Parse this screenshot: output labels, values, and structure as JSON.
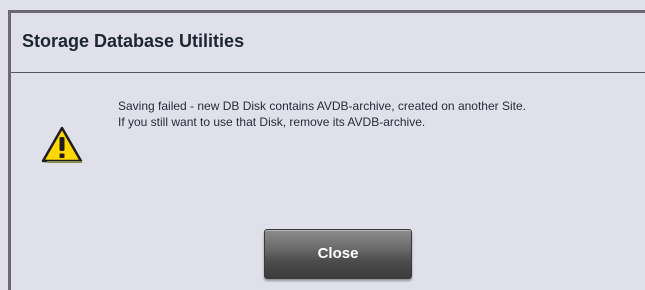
{
  "dialog": {
    "title": "Storage Database Utilities",
    "icon": "warning-icon",
    "message_line1": "Saving failed - new DB Disk contains AVDB-archive, created on another Site.",
    "message_line2": "If you still want to use that Disk, remove its AVDB-archive.",
    "close_label": "Close"
  },
  "colors": {
    "background": "#e0e0ea",
    "frame": "#6a6a70",
    "title_text": "#1c2530",
    "warning_fill": "#ffd800",
    "button": "#5a5a5a"
  }
}
